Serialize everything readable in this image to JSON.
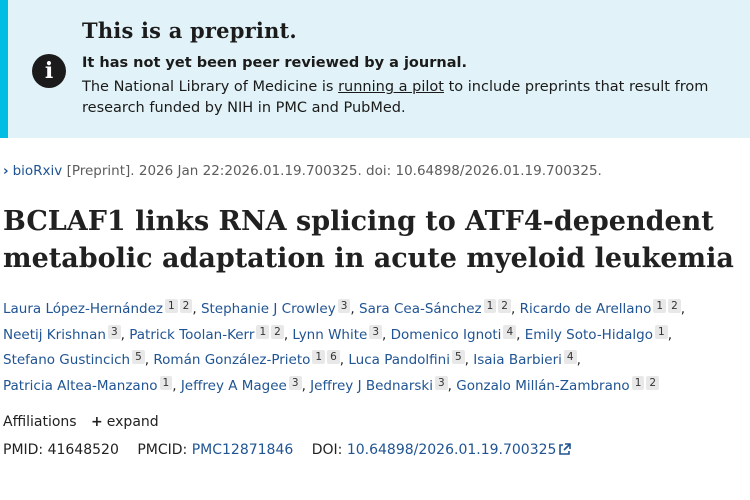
{
  "banner": {
    "title": "This is a preprint.",
    "bold": "It has not yet been peer reviewed by a journal.",
    "text_before": "The National Library of Medicine is ",
    "link": "running a pilot",
    "text_after": " to include preprints that result from research funded by NIH in PMC and PubMed.",
    "icon": "info-icon",
    "accent_color": "#00bde3",
    "background_color": "#e1f3f8"
  },
  "citation": {
    "journal": "bioRxiv",
    "details": "[Preprint]. 2026 Jan 22:2026.01.19.700325. doi: 10.64898/2026.01.19.700325."
  },
  "article": {
    "title": "BCLAF1 links RNA splicing to ATF4-dependent metabolic adaptation in acute myeloid leukemia"
  },
  "authors": [
    {
      "name": "Laura López-Hernández",
      "affs": [
        "1",
        "2"
      ]
    },
    {
      "name": "Stephanie J Crowley",
      "affs": [
        "3"
      ]
    },
    {
      "name": "Sara Cea-Sánchez",
      "affs": [
        "1",
        "2"
      ]
    },
    {
      "name": "Ricardo de Arellano",
      "affs": [
        "1",
        "2"
      ]
    },
    {
      "name": "Neetij Krishnan",
      "affs": [
        "3"
      ]
    },
    {
      "name": "Patrick Toolan-Kerr",
      "affs": [
        "1",
        "2"
      ]
    },
    {
      "name": "Lynn White",
      "affs": [
        "3"
      ]
    },
    {
      "name": "Domenico Ignoti",
      "affs": [
        "4"
      ]
    },
    {
      "name": "Emily Soto-Hidalgo",
      "affs": [
        "1"
      ]
    },
    {
      "name": "Stefano Gustincich",
      "affs": [
        "5"
      ]
    },
    {
      "name": "Román González-Prieto",
      "affs": [
        "1",
        "6"
      ]
    },
    {
      "name": "Luca Pandolfini",
      "affs": [
        "5"
      ]
    },
    {
      "name": "Isaia Barbieri",
      "affs": [
        "4"
      ]
    },
    {
      "name": "Patricia Altea-Manzano",
      "affs": [
        "1"
      ]
    },
    {
      "name": "Jeffrey A Magee",
      "affs": [
        "3"
      ]
    },
    {
      "name": "Jeffrey J Bednarski",
      "affs": [
        "3"
      ]
    },
    {
      "name": "Gonzalo Millán-Zambrano",
      "affs": [
        "1",
        "2"
      ]
    }
  ],
  "affiliations": {
    "label": "Affiliations",
    "toggle": "expand",
    "toggle_icon": "plus-icon"
  },
  "ids": {
    "pmid_label": "PMID:",
    "pmid": "41648520",
    "pmcid_label": "PMCID:",
    "pmcid": "PMC12871846",
    "doi_label": "DOI:",
    "doi": "10.64898/2026.01.19.700325",
    "doi_icon": "external-link-icon"
  },
  "colors": {
    "link": "#205493",
    "text": "#212121"
  }
}
